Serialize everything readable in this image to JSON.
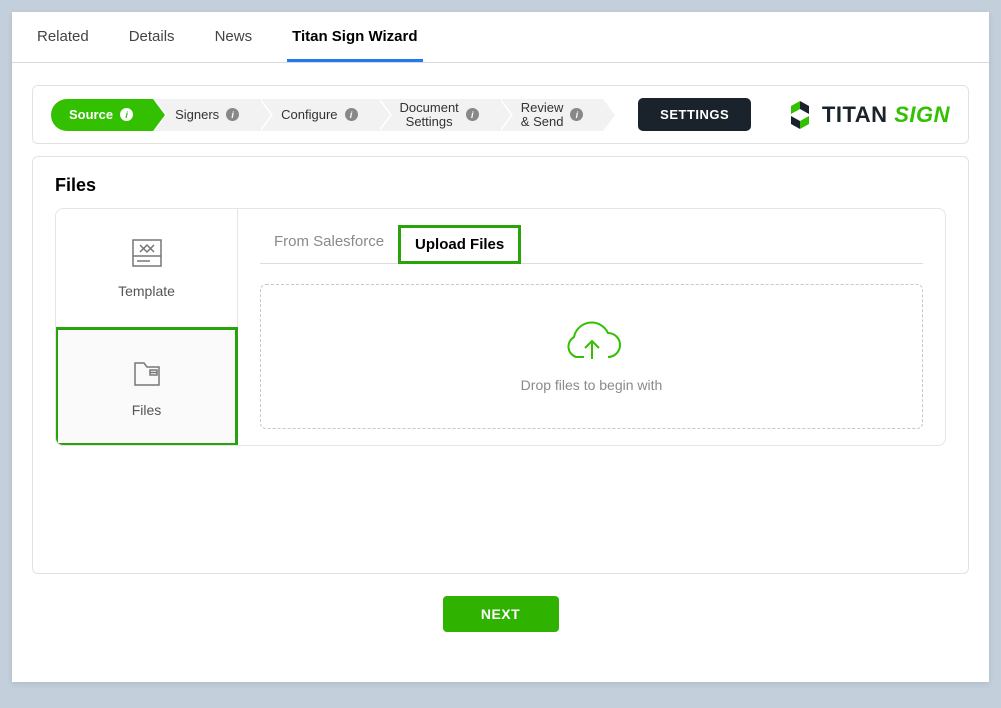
{
  "tabs": {
    "related": "Related",
    "details": "Details",
    "news": "News",
    "titan_sign_wizard": "Titan Sign Wizard"
  },
  "wizard": {
    "steps": {
      "source": "Source",
      "signers": "Signers",
      "configure": "Configure",
      "document_settings_line1": "Document",
      "document_settings_line2": "Settings",
      "review_send_line1": "Review",
      "review_send_line2": "& Send"
    },
    "settings_button": "SETTINGS",
    "brand_titan": "TITAN",
    "brand_sign": "SIGN"
  },
  "files": {
    "title": "Files",
    "sidebar": {
      "template": "Template",
      "files": "Files"
    },
    "sub_tabs": {
      "from_salesforce": "From Salesforce",
      "upload_files": "Upload Files"
    },
    "drop_message": "Drop files to begin with"
  },
  "buttons": {
    "next": "NEXT"
  },
  "colors": {
    "accent_green": "#33c000",
    "dark": "#1a232b"
  }
}
